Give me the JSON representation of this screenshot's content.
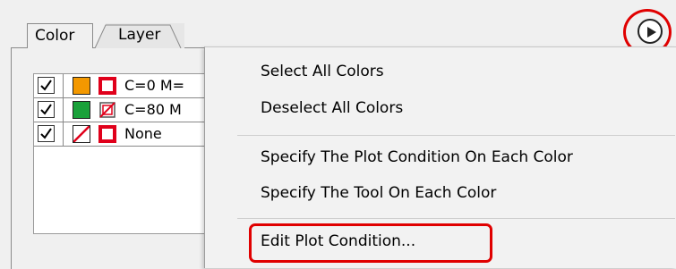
{
  "tabs": [
    {
      "label": "Color"
    },
    {
      "label": "Layer"
    }
  ],
  "color_list": {
    "rows": [
      {
        "checked": true,
        "swatch_color": "#f39800",
        "tool": "box",
        "text": "C=0 M="
      },
      {
        "checked": true,
        "swatch_color": "#1aa13a",
        "tool": "none-slash",
        "text": "C=80 M"
      },
      {
        "checked": true,
        "swatch_color": "none",
        "tool": "box",
        "text": "None"
      }
    ]
  },
  "panel_menu_icon": "circle-play-icon",
  "menu": {
    "items": [
      {
        "label": "Select All Colors"
      },
      {
        "label": "Deselect All Colors"
      },
      {
        "label": "Specify The Plot Condition On Each Color"
      },
      {
        "label": "Specify The Tool On Each Color"
      },
      {
        "label": "Edit Plot Condition..."
      }
    ]
  },
  "colors": {
    "highlight": "#e00000",
    "orange": "#f39800",
    "green": "#1aa13a",
    "tool_red": "#e0001b"
  }
}
